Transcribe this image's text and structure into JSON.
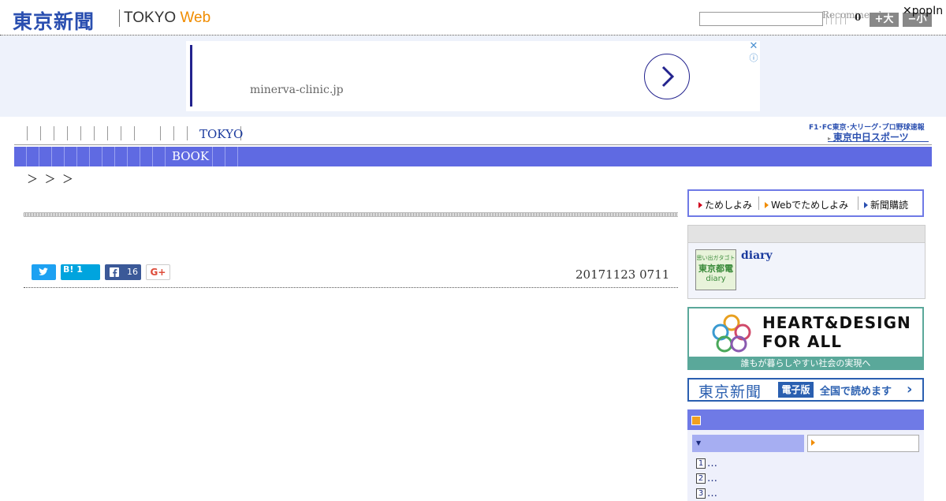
{
  "header": {
    "logo_main": "東京新聞",
    "logo_tokyo": "TOKYO",
    "logo_web": "Web",
    "search_value": "",
    "recommend": "Recommend",
    "counter": "0",
    "font_big": "+大",
    "font_small": "−小",
    "popin": "popIn"
  },
  "ad": {
    "url": "minerva-clinic.jp",
    "close": "✕",
    "info": "ⓘ"
  },
  "nav": {
    "tokyo_item": "TOKYO",
    "chunichi_line1": "F1･FC東京･大リーグ･プロ野球速報",
    "chunichi_line2": "東京中日スポーツ",
    "book_item": "BOOK"
  },
  "breadcrumb": "＞ ＞ ＞",
  "article": {
    "hatena_count": "1",
    "fb_count": "16",
    "gplus": "G+",
    "date": "20171123 0711"
  },
  "sidebar": {
    "promo": [
      {
        "label": "ためしよみ",
        "color": "#d0021b"
      },
      {
        "label": "Webでためしよみ",
        "color": "#f08c00"
      },
      {
        "label": "新聞購読",
        "color": "#2a4fb0"
      }
    ],
    "diary_title": "diary",
    "diary_thumb_line1": "思い出ガタゴト",
    "diary_thumb_line2": "東京都電",
    "diary_thumb_line3": "diary",
    "heart_line1": "HEART&DESIGN",
    "heart_line2": "FOR ALL",
    "heart_caption": "誰もが暮らしやすい社会の実現へ",
    "ebook_title": "東京新聞",
    "ebook_tag": "電子版",
    "ebook_text": "全国で読めます",
    "ranking": [
      {
        "num": "1",
        "text": "…"
      },
      {
        "num": "2",
        "text": "…"
      },
      {
        "num": "3",
        "text": "…"
      }
    ]
  },
  "colors": {
    "nav_blue": "#5f6ae2",
    "logo_blue": "#2a4fb0",
    "web_orange": "#f08c00"
  }
}
